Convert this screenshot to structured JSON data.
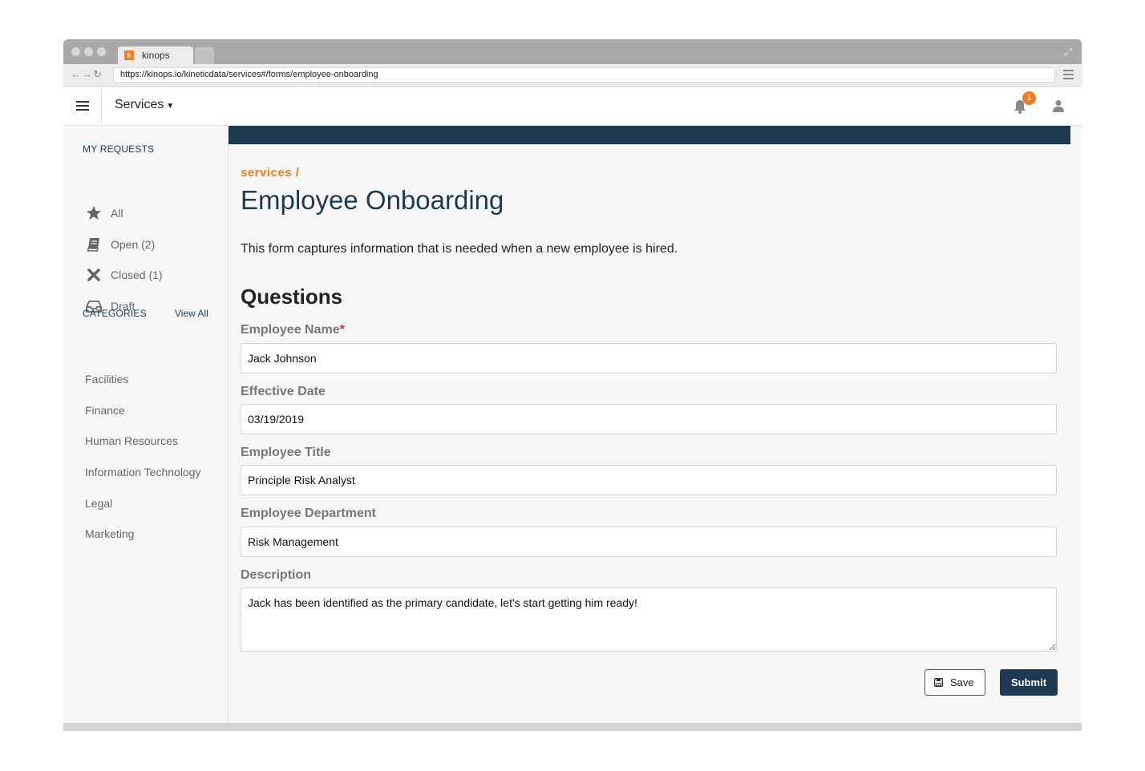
{
  "browser": {
    "tab_title": "kinops",
    "favicon_letter": "k",
    "url": "https://kinops.io/kineticdata/services#/forms/employee-onboarding"
  },
  "header": {
    "menu_label": "Services",
    "notification_count": "1"
  },
  "sidebar": {
    "my_requests_heading": "MY REQUESTS",
    "requests": [
      {
        "label": "All",
        "icon": "star-icon"
      },
      {
        "label": "Open (2)",
        "icon": "book-icon"
      },
      {
        "label": "Closed (1)",
        "icon": "x-icon"
      },
      {
        "label": "Draft",
        "icon": "inbox-icon"
      }
    ],
    "categories_heading": "CATEGORIES",
    "view_all_label": "View All",
    "categories": [
      "Facilities",
      "Finance",
      "Human Resources",
      "Information Technology",
      "Legal",
      "Marketing"
    ]
  },
  "main": {
    "breadcrumb": "services /",
    "title": "Employee Onboarding",
    "description": "This form captures information that is needed when a new employee is hired.",
    "section_title": "Questions",
    "fields": [
      {
        "label": "Employee Name",
        "value": "Jack Johnson",
        "required": true
      },
      {
        "label": "Effective Date",
        "value": "03/19/2019"
      },
      {
        "label": "Employee Title",
        "value": "Principle Risk Analyst"
      },
      {
        "label": "Employee Department",
        "value": "Risk Management"
      },
      {
        "label": "Description",
        "value": "Jack has been identified as the primary candidate, let's start getting him ready!"
      }
    ],
    "required_marker": "*",
    "save_label": "Save",
    "submit_label": "Submit"
  },
  "colors": {
    "accent": "#f47b20",
    "navy": "#1e3a52"
  }
}
